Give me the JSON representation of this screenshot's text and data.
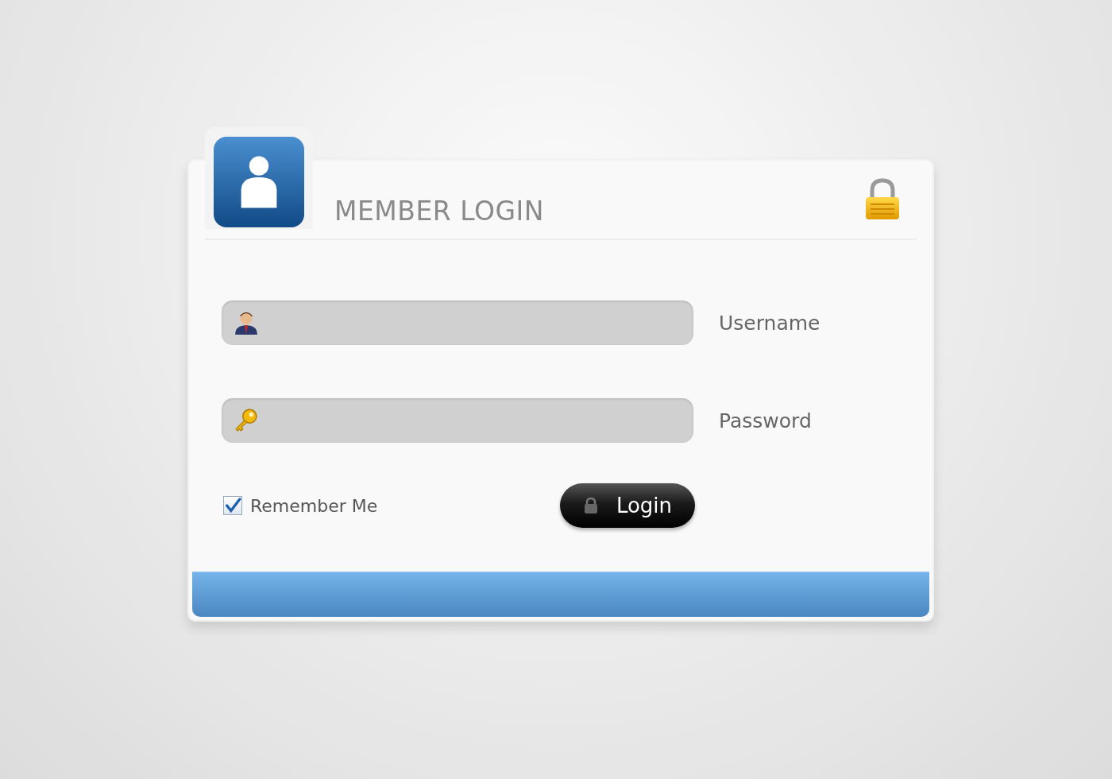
{
  "title": "MEMBER LOGIN",
  "fields": [
    {
      "kind": "username",
      "label": "Username"
    },
    {
      "kind": "password",
      "label": "Password"
    }
  ],
  "remember": {
    "label": "Remember Me",
    "checked": true
  },
  "login_button": {
    "label": "Login"
  }
}
